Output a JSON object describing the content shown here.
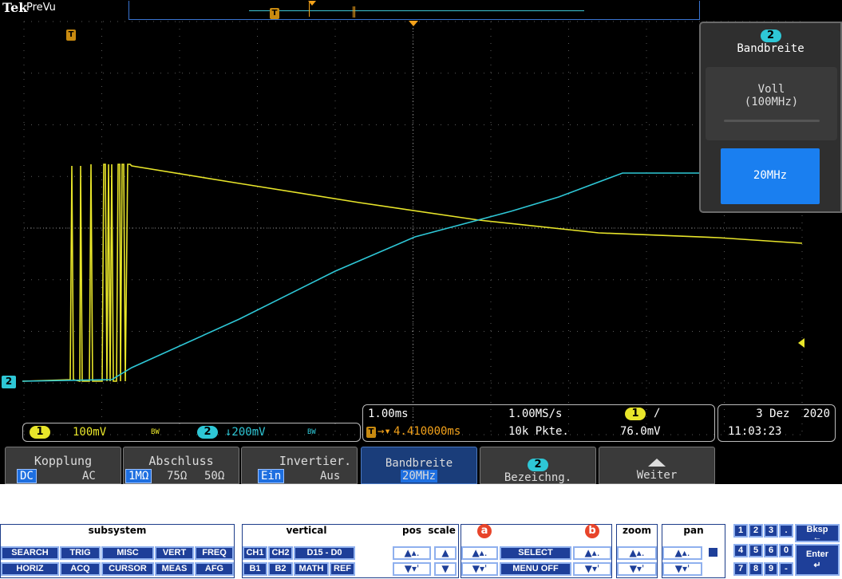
{
  "header": {
    "brand": "Tek",
    "mode": "PreVu"
  },
  "markers": {
    "trigger": "T",
    "ch2_ref": "2",
    "ch1_chip": "1",
    "ch2_chip": "2"
  },
  "side_menu": {
    "channel": "2",
    "title": "Bandbreite",
    "options": [
      {
        "line1": "Voll",
        "line2": "(100MHz)",
        "selected": false
      },
      {
        "line1": "20MHz",
        "line2": "",
        "selected": true
      }
    ]
  },
  "channels": {
    "ch1": {
      "scale": "100mV",
      "bw": "BW",
      "color": "#e8e52a"
    },
    "ch2": {
      "scale": "↓200mV",
      "bw": "BW",
      "color": "#2ec7d6"
    }
  },
  "timebase": {
    "per_div": "1.00ms",
    "delay": "4.410000ms",
    "rate": "1.00MS/s",
    "points": "10k Pkte."
  },
  "trigger": {
    "source": "1",
    "slope": "∕",
    "level": "76.0mV"
  },
  "datetime": {
    "date": "3 Dez  2020",
    "time": "11:03:23"
  },
  "softkeys": [
    {
      "label": "Kopplung",
      "opts": [
        "DC",
        "AC"
      ],
      "on": 0
    },
    {
      "label": "Abschluss",
      "opts": [
        "1MΩ",
        "75Ω",
        "50Ω"
      ],
      "on": 0
    },
    {
      "label": "Invertier.",
      "opts": [
        "Ein",
        "Aus"
      ],
      "on": 0
    },
    {
      "label": "Bandbreite",
      "value": "20MHz"
    },
    {
      "label": "Bezeichng.",
      "chip": "2"
    },
    {
      "label": "Weiter",
      "icon": "up-arrow-icon"
    }
  ],
  "panel": {
    "subsystem": {
      "title": "subsystem",
      "row1": [
        "SEARCH",
        "TRIG",
        "MISC",
        "VERT",
        "FREQ"
      ],
      "row2": [
        "HORIZ",
        "ACQ",
        "CURSOR",
        "MEAS",
        "AFG"
      ]
    },
    "vertical": {
      "title": "vertical",
      "pos_scale": "pos  scale",
      "row1": [
        "CH1",
        "CH2",
        "D15 - D0"
      ],
      "row2": [
        "B1",
        "B2",
        "MATH",
        "REF"
      ]
    },
    "select": {
      "badge_a": "a",
      "badge_b": "b",
      "select": "SELECT",
      "menu_off": "MENU OFF"
    },
    "zoom": {
      "title": "zoom"
    },
    "pan": {
      "title": "pan"
    },
    "keypad": {
      "row1": [
        "1",
        "2",
        "3",
        "."
      ],
      "row2": [
        "4",
        "5",
        "6",
        "0"
      ],
      "row3": [
        "7",
        "8",
        "9",
        "-"
      ],
      "bksp": "Bksp",
      "enter": "Enter"
    }
  }
}
